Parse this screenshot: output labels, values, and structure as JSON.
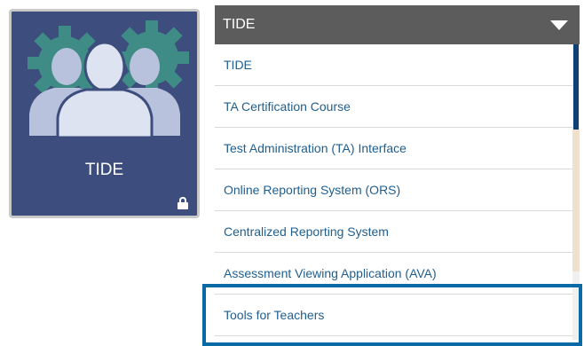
{
  "tile": {
    "label": "TIDE",
    "art_icon": "users-gears-icon",
    "lock_icon": "lock-icon",
    "colors": {
      "background": "#3c4d7e",
      "gear": "#3f8b86",
      "person": "#b9c2dc",
      "person_front": "#dde3f0"
    }
  },
  "dropdown": {
    "selected": "TIDE",
    "caret_icon": "caret-down-icon",
    "items": [
      {
        "label": "TIDE"
      },
      {
        "label": "TA Certification Course"
      },
      {
        "label": "Test Administration (TA) Interface"
      },
      {
        "label": "Online Reporting System (ORS)"
      },
      {
        "label": "Centralized Reporting System"
      },
      {
        "label": "Assessment Viewing Application (AVA)"
      },
      {
        "label": "Tools for Teachers"
      }
    ],
    "colors": {
      "header": "#5c5c5c",
      "link": "#1f5e8f",
      "highlight": "#0a6aa5"
    }
  }
}
